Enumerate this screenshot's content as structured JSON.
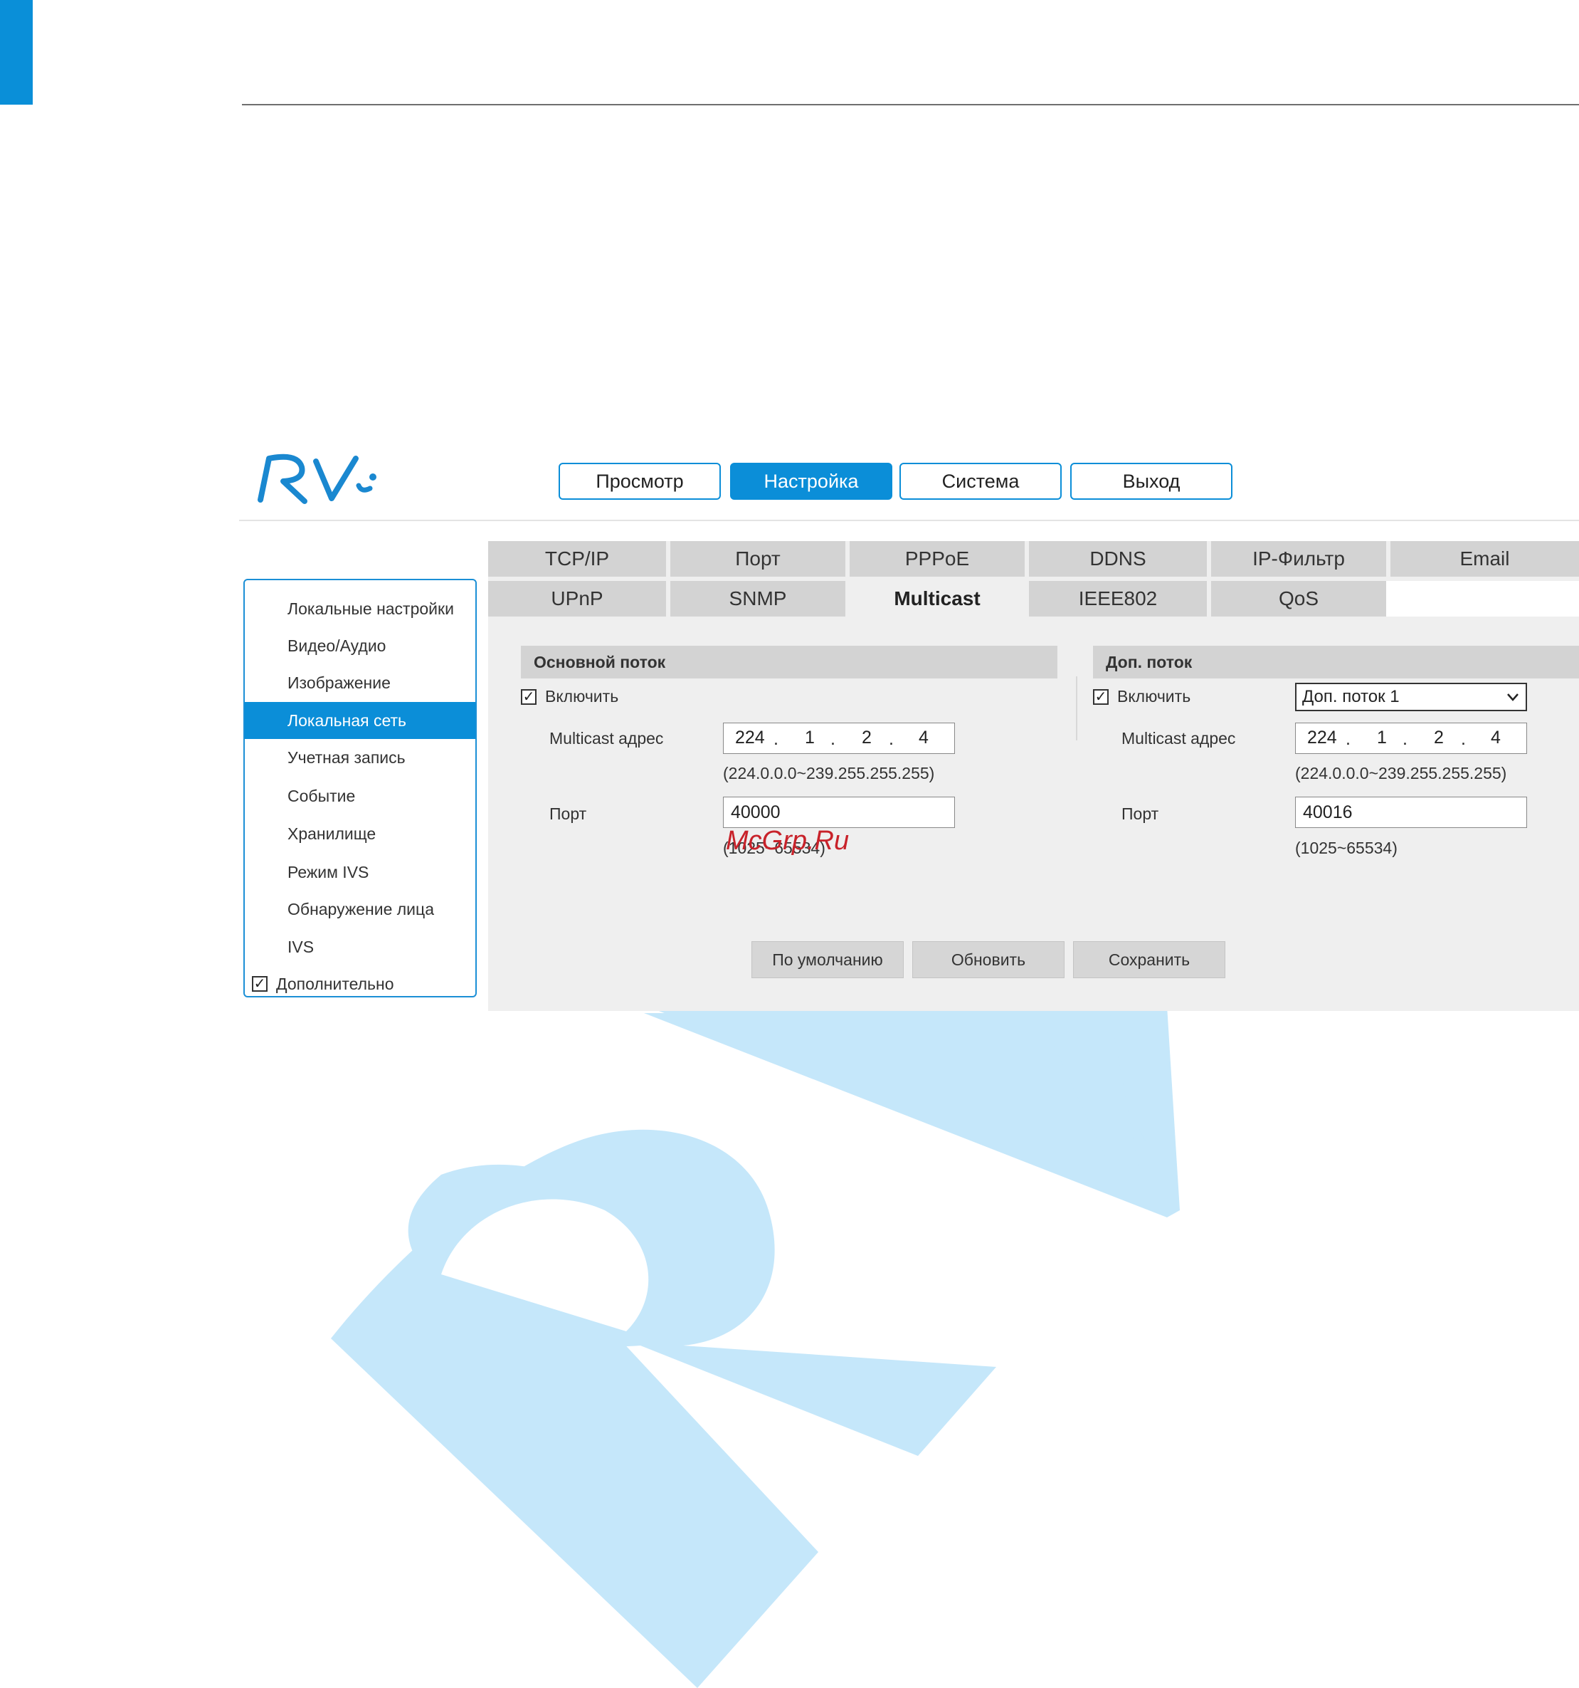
{
  "brand": {
    "logo_text": "RVi"
  },
  "nav": {
    "items": [
      {
        "label": "Просмотр",
        "active": false
      },
      {
        "label": "Настройка",
        "active": true
      },
      {
        "label": "Система",
        "active": false
      },
      {
        "label": "Выход",
        "active": false
      }
    ]
  },
  "sidebar": {
    "items": [
      {
        "label": "Локальные настройки",
        "active": false
      },
      {
        "label": "Видео/Аудио",
        "active": false
      },
      {
        "label": "Изображение",
        "active": false
      },
      {
        "label": "Локальная сеть",
        "active": true
      },
      {
        "label": "Учетная запись",
        "active": false
      },
      {
        "label": "Событие",
        "active": false
      },
      {
        "label": "Хранилище",
        "active": false
      },
      {
        "label": "Режим IVS",
        "active": false
      },
      {
        "label": "Обнаружение лица",
        "active": false
      },
      {
        "label": "IVS",
        "active": false
      }
    ],
    "extra": {
      "label": "Дополнительно",
      "checked": true
    }
  },
  "tabs": {
    "row1": [
      "TCP/IP",
      "Порт",
      "PPPoE",
      "DDNS",
      "IP-Фильтр",
      "Email"
    ],
    "row2": [
      "UPnP",
      "SNMP",
      "Multicast",
      "IEEE802",
      "QoS"
    ],
    "active": "Multicast"
  },
  "main_stream": {
    "title": "Основной поток",
    "enable_label": "Включить",
    "enabled": true,
    "address_label": "Multicast адрес",
    "address": [
      "224",
      "1",
      "2",
      "4"
    ],
    "address_hint": "(224.0.0.0~239.255.255.255)",
    "port_label": "Порт",
    "port": "40000",
    "port_hint": "(1025~65534)"
  },
  "sub_stream": {
    "title": "Доп. поток",
    "enable_label": "Включить",
    "enabled": true,
    "stream_select": "Доп. поток 1",
    "address_label": "Multicast адрес",
    "address": [
      "224",
      "1",
      "2",
      "4"
    ],
    "address_hint": "(224.0.0.0~239.255.255.255)",
    "port_label": "Порт",
    "port": "40016",
    "port_hint": "(1025~65534)"
  },
  "actions": {
    "default_label": "По умолчанию",
    "refresh_label": "Обновить",
    "save_label": "Сохранить"
  },
  "overlay": {
    "watermark_text": "McGrp.Ru"
  },
  "colors": {
    "accent": "#0b8ed8",
    "watermark": "#c5e7fa",
    "panel": "#efefef",
    "tab": "#d3d3d3"
  }
}
